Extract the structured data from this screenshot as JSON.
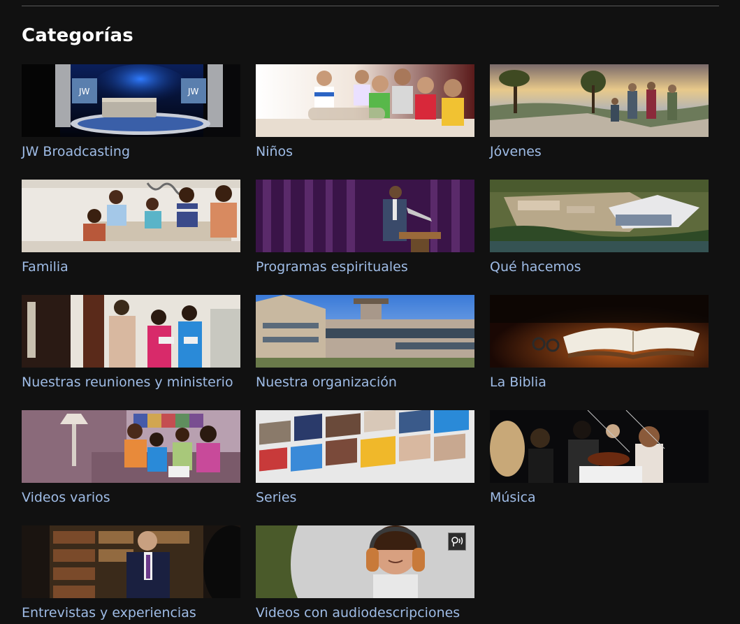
{
  "section": {
    "title": "Categorías"
  },
  "categories": [
    {
      "label": "JW Broadcasting",
      "thumbnail": "studio-desk-image"
    },
    {
      "label": "Niños",
      "thumbnail": "children-sitting-image"
    },
    {
      "label": "Jóvenes",
      "thumbnail": "youth-hiking-image"
    },
    {
      "label": "Familia",
      "thumbnail": "family-reading-image"
    },
    {
      "label": "Programas espirituales",
      "thumbnail": "speaker-podium-image"
    },
    {
      "label": "Qué hacemos",
      "thumbnail": "construction-site-image"
    },
    {
      "label": "Nuestras reuniones y ministerio",
      "thumbnail": "doorstep-ministry-image"
    },
    {
      "label": "Nuestra organización",
      "thumbnail": "headquarters-building-image"
    },
    {
      "label": "La Biblia",
      "thumbnail": "open-bible-image"
    },
    {
      "label": "Videos varios",
      "thumbnail": "family-couch-image"
    },
    {
      "label": "Series",
      "thumbnail": "series-collage-image"
    },
    {
      "label": "Música",
      "thumbnail": "orchestra-image"
    },
    {
      "label": "Entrevistas y experiencias",
      "thumbnail": "interview-image"
    },
    {
      "label": "Videos con audiodescripciones",
      "thumbnail": "headphones-listener-image",
      "badge": "audio-description-icon"
    }
  ],
  "colors": {
    "background": "#111111",
    "heading": "#ffffff",
    "link": "#9fbce6",
    "divider": "#5a5a5a"
  }
}
